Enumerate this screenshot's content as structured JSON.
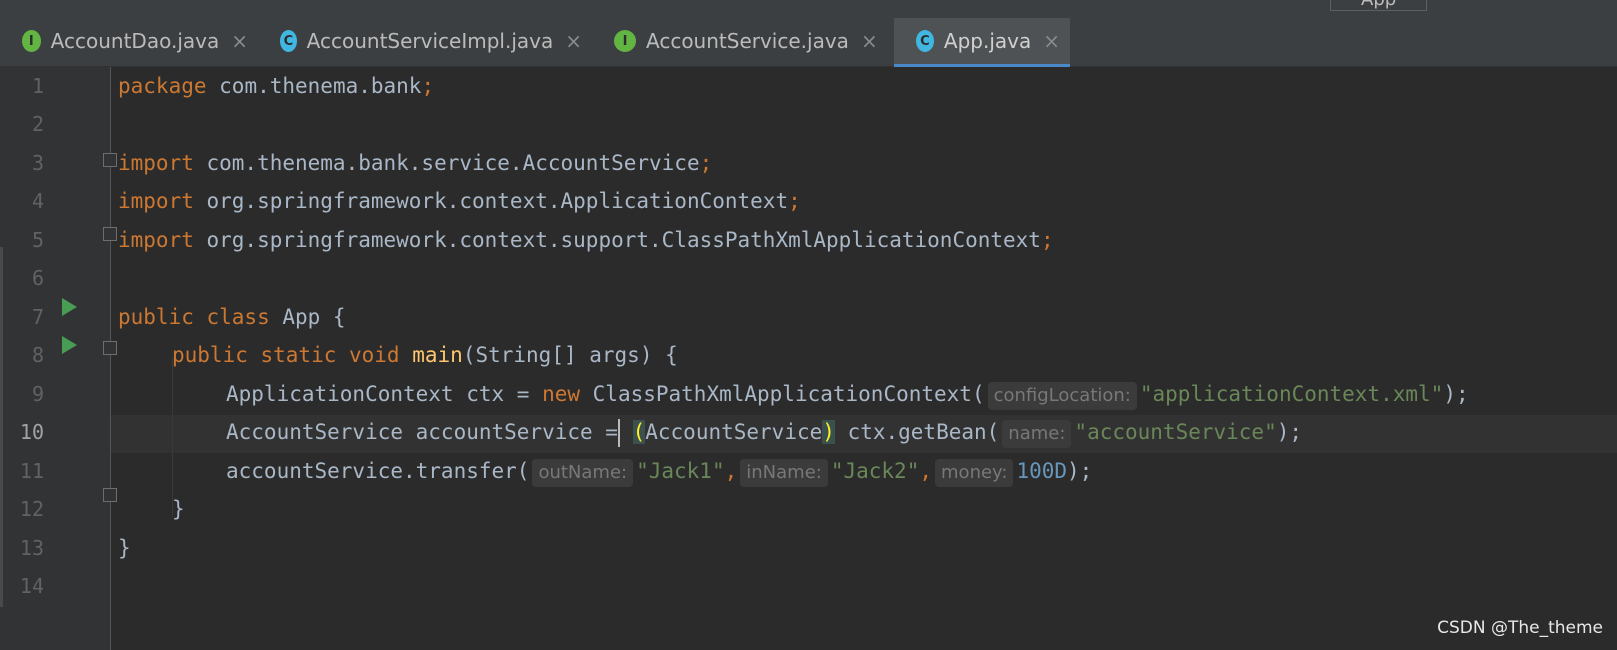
{
  "tabs": [
    {
      "label": "AccountDao.java",
      "icon": "interface-icon",
      "icon_letter": "I",
      "active": false
    },
    {
      "label": "AccountServiceImpl.java",
      "icon": "class-icon",
      "icon_letter": "C",
      "active": false
    },
    {
      "label": "AccountService.java",
      "icon": "interface-icon",
      "icon_letter": "I",
      "active": false
    },
    {
      "label": "App.java",
      "icon": "runnable-class-icon",
      "icon_letter": "C",
      "active": true
    }
  ],
  "close_glyph": "×",
  "run_config": "App",
  "line_numbers": [
    "1",
    "2",
    "3",
    "4",
    "5",
    "6",
    "7",
    "8",
    "9",
    "10",
    "11",
    "12",
    "13",
    "14"
  ],
  "current_line": "10",
  "code": {
    "l1_kw": "package",
    "l1_rest": " com.thenema.bank",
    "l1_semi": ";",
    "l3_kw": "import",
    "l3_rest": " com.thenema.bank.service.AccountService",
    "l3_semi": ";",
    "l4_kw": "import",
    "l4_rest": " org.springframework.context.ApplicationContext",
    "l4_semi": ";",
    "l5_kw": "import",
    "l5_rest": " org.springframework.context.support.ClassPathXmlApplicationContext",
    "l5_semi": ";",
    "l7_kw": "public class",
    "l7_rest": " App {",
    "l8_kw": "public static void",
    "l8_fn": "main",
    "l8_rest": "(String[] args) {",
    "l9_a": "ApplicationContext ctx = ",
    "l9_kw": "new",
    "l9_b": " ClassPathXmlApplicationContext(",
    "l9_hint": "configLocation:",
    "l9_str": "\"applicationContext.xml\"",
    "l9_end": ");",
    "l10_a": "AccountService accountService =",
    "l10_open": "(",
    "l10_b": "AccountService",
    "l10_close": ")",
    "l10_c": " ctx.getBean(",
    "l10_hint": "name:",
    "l10_str": "\"accountService\"",
    "l10_end": ");",
    "l11_a": "accountService.transfer(",
    "l11_hint1": "outName:",
    "l11_str1": "\"Jack1\"",
    "l11_comma1": ",",
    "l11_hint2": "inName:",
    "l11_str2": "\"Jack2\"",
    "l11_comma2": ",",
    "l11_hint3": "money:",
    "l11_num": "100D",
    "l11_end": ");",
    "l12": "}",
    "l13": "}"
  },
  "watermark": "CSDN @The_theme",
  "colors": {
    "keyword": "#cc7832",
    "string": "#6a8759",
    "number": "#6897bb",
    "function": "#ffc66d",
    "text": "#a9b7c6",
    "run": "#499c54"
  }
}
